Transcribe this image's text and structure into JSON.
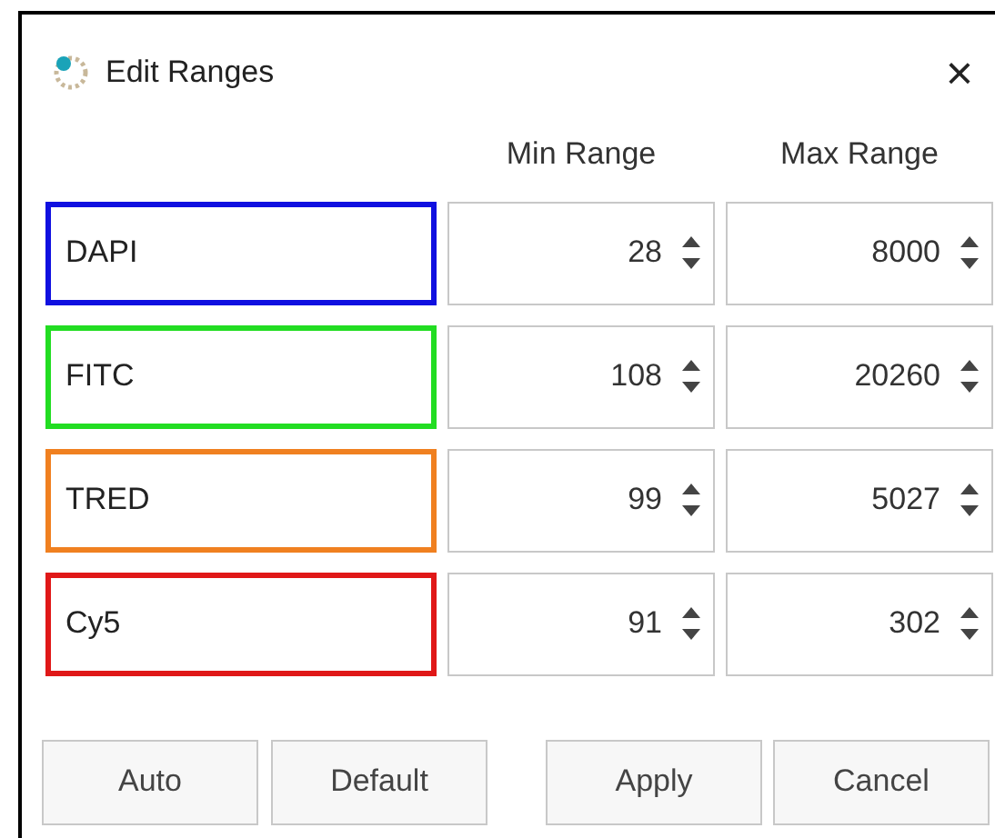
{
  "window": {
    "title": "Edit Ranges",
    "close": "×"
  },
  "columns": [
    "Min Range",
    "Max Range"
  ],
  "channels": [
    {
      "name": "DAPI",
      "color": "#1010e0",
      "min": "28",
      "max": "8000"
    },
    {
      "name": "FITC",
      "color": "#22dd22",
      "min": "108",
      "max": "20260"
    },
    {
      "name": "TRED",
      "color": "#f08020",
      "min": "99",
      "max": "5027"
    },
    {
      "name": "Cy5",
      "color": "#e01818",
      "min": "91",
      "max": "302"
    }
  ],
  "buttons": [
    "Auto",
    "Default",
    "Apply",
    "Cancel"
  ]
}
